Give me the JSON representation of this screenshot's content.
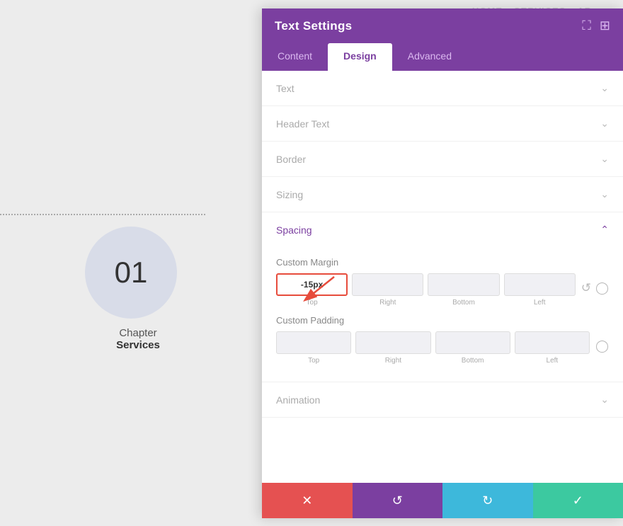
{
  "page": {
    "nav": [
      "HOME",
      "SERVICES",
      "AB..."
    ],
    "chapter_number": "01",
    "chapter_text": "Chapter",
    "chapter_bold": "Services"
  },
  "panel": {
    "title": "Text Settings",
    "header_icons": [
      "⛶",
      "⊞"
    ],
    "tabs": [
      {
        "label": "Content",
        "active": false
      },
      {
        "label": "Design",
        "active": true
      },
      {
        "label": "Advanced",
        "active": false
      }
    ],
    "sections": [
      {
        "label": "Text",
        "expanded": false
      },
      {
        "label": "Header Text",
        "expanded": false
      },
      {
        "label": "Border",
        "expanded": false
      },
      {
        "label": "Sizing",
        "expanded": false
      }
    ],
    "spacing": {
      "label": "Spacing",
      "expanded": true,
      "custom_margin": {
        "title": "Custom Margin",
        "fields": [
          {
            "label": "Top",
            "value": "-15px",
            "highlighted": true
          },
          {
            "label": "Right",
            "value": ""
          },
          {
            "label": "Bottom",
            "value": ""
          },
          {
            "label": "Left",
            "value": ""
          }
        ]
      },
      "custom_padding": {
        "title": "Custom Padding",
        "fields": [
          {
            "label": "Top",
            "value": ""
          },
          {
            "label": "Right",
            "value": ""
          },
          {
            "label": "Bottom",
            "value": ""
          },
          {
            "label": "Left",
            "value": ""
          }
        ]
      }
    },
    "animation": {
      "label": "Animation",
      "expanded": false
    },
    "footer": {
      "cancel_icon": "✕",
      "undo_icon": "↺",
      "redo_icon": "↻",
      "save_icon": "✓"
    }
  }
}
